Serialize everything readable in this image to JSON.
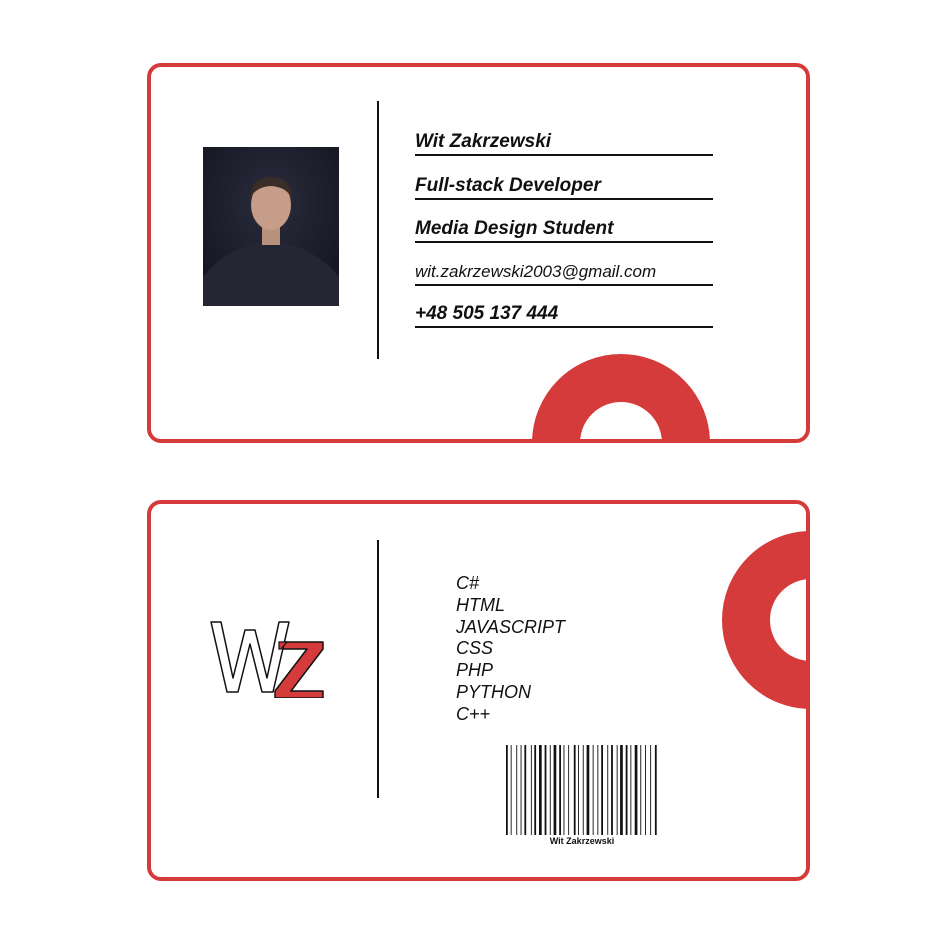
{
  "colors": {
    "accent": "#d63b3b",
    "ink": "#111111",
    "background": "#ffffff"
  },
  "front": {
    "photo": "portrait-photo",
    "name": "Wit Zakrzewski",
    "role": "Full-stack Developer",
    "study": "Media Design Student",
    "email": "wit.zakrzewski2003@gmail.com",
    "phone": "+48 505 137 444"
  },
  "back": {
    "logo_letters": "WZ",
    "skills": [
      "C#",
      "HTML",
      "JAVASCRIPT",
      "CSS",
      "PHP",
      "PYTHON",
      "C++"
    ],
    "barcode_caption": "Wit Zakrzewski"
  }
}
